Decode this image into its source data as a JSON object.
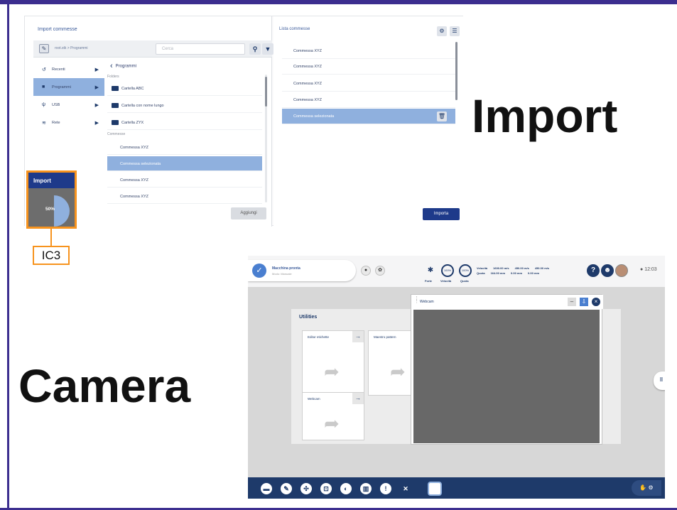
{
  "labels": {
    "import": "Import",
    "camera": "Camera",
    "callout": "IC3"
  },
  "colors": {
    "frame": "#3c2e8f",
    "callout": "#f7931e",
    "accent": "#1e3a8a",
    "selection": "#8fb0de"
  },
  "import_screen": {
    "title": "Import commesse",
    "path": "root.stk > Programmi",
    "search_placeholder": "Cerca",
    "nav": [
      {
        "label": "Recenti",
        "icon": "history-icon"
      },
      {
        "label": "Programmi",
        "icon": "folder-icon",
        "active": true
      },
      {
        "label": "USB",
        "icon": "usb-icon"
      },
      {
        "label": "Rete",
        "icon": "wifi-icon"
      }
    ],
    "back_label": "Programmi",
    "folders_header": "Folders",
    "folders": [
      "Cartella ABC",
      "Cartella con nome lungo",
      "Cartella ZYX"
    ],
    "jobs_header": "Commesse",
    "jobs": [
      "Commessa XYZ",
      "Commessa selezionata",
      "Commessa XYZ",
      "Commessa XYZ"
    ],
    "add_button": "Aggiungi",
    "list_title": "Lista commesse",
    "list": [
      "Commessa XYZ",
      "Commessa XYZ",
      "Commessa XYZ",
      "Commessa XYZ",
      "Commessa selezionata"
    ],
    "import_button": "Importa",
    "popup": {
      "title": "Import",
      "progress_label": "50%",
      "progress": 0.5
    }
  },
  "camera_screen": {
    "status": "Macchina pronta",
    "status_sub": "Modo: Manuale",
    "gauges": [
      {
        "value": "100%",
        "label": "Velocità"
      },
      {
        "value": "100%",
        "label": "Quota"
      }
    ],
    "gauge_left_label": "Forte",
    "stats": [
      [
        "Velocità",
        "1600.00 m/s",
        "450.00 m/s",
        "450.00 m/s"
      ],
      [
        "Quota",
        "164.00 mm",
        "0.00 mm",
        "0.00 mm"
      ]
    ],
    "time": "12:03",
    "utilities": {
      "title": "Utilities",
      "tiles": [
        "Editor etichette",
        "Maestro pattern",
        "Webcam"
      ]
    },
    "webcam": {
      "title": "Webcam"
    }
  }
}
